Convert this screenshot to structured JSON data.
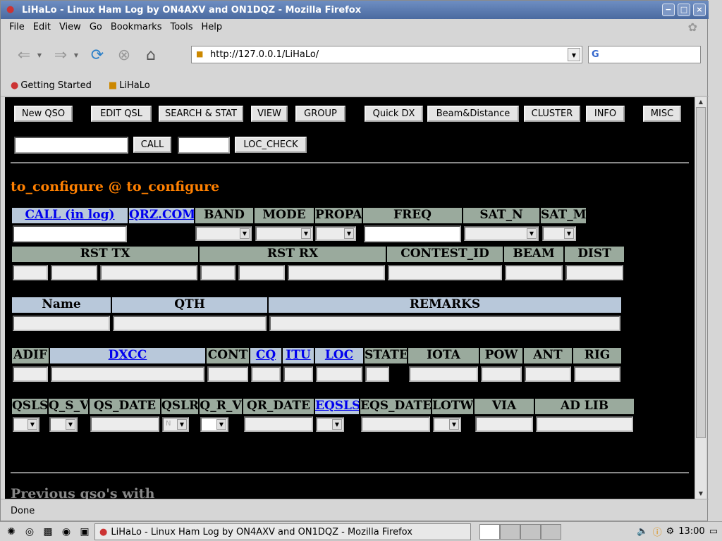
{
  "window": {
    "title": "LiHaLo - Linux Ham Log by ON4AXV and ON1DQZ - Mozilla Firefox",
    "controls": [
      "−",
      "□",
      "×"
    ]
  },
  "menu": [
    "File",
    "Edit",
    "View",
    "Go",
    "Bookmarks",
    "Tools",
    "Help"
  ],
  "nav": {
    "url": "http://127.0.0.1/LiHaLo/",
    "search_placeholder": ""
  },
  "bookmarks": [
    "Getting Started",
    "LiHaLo"
  ],
  "toolbar_buttons": [
    "New QSO",
    "EDIT QSL",
    "SEARCH & STAT",
    "VIEW",
    "GROUP",
    "Quick DX",
    "Beam&Distance",
    "CLUSTER",
    "INFO",
    "MISC"
  ],
  "call_form": {
    "call_button": "CALL",
    "loc_button": "LOC_CHECK"
  },
  "station": "to_configure @ to_configure",
  "row1_headers": [
    {
      "label": "CALL (in log)",
      "link": true
    },
    {
      "label": "QRZ.COM",
      "link": true
    },
    {
      "label": "BAND",
      "link": false
    },
    {
      "label": "MODE",
      "link": false
    },
    {
      "label": "PROPA",
      "link": false
    },
    {
      "label": "FREQ",
      "link": false
    },
    {
      "label": "SAT_N",
      "link": false
    },
    {
      "label": "SAT_M",
      "link": false
    }
  ],
  "row2_headers": [
    "RST TX",
    "RST RX",
    "CONTEST_ID",
    "BEAM",
    "DIST"
  ],
  "row3_headers": [
    "Name",
    "QTH",
    "REMARKS"
  ],
  "row4_headers": [
    {
      "label": "ADIF",
      "link": false
    },
    {
      "label": "DXCC",
      "link": true
    },
    {
      "label": "CONT",
      "link": false
    },
    {
      "label": "CQ",
      "link": true
    },
    {
      "label": "ITU",
      "link": true
    },
    {
      "label": "LOC",
      "link": true
    },
    {
      "label": "STATE",
      "link": false
    },
    {
      "label": "IOTA",
      "link": false
    },
    {
      "label": "POW",
      "link": false
    },
    {
      "label": "ANT",
      "link": false
    },
    {
      "label": "RIG",
      "link": false
    }
  ],
  "row5_headers": [
    {
      "label": "QSLS",
      "link": false
    },
    {
      "label": "Q_S_V",
      "link": false
    },
    {
      "label": "QS_DATE",
      "link": false
    },
    {
      "label": "QSLR",
      "link": false
    },
    {
      "label": "Q_R_V",
      "link": false
    },
    {
      "label": "QR_DATE",
      "link": false
    },
    {
      "label": "EQSLS",
      "link": true
    },
    {
      "label": "EQS_DATE",
      "link": false
    },
    {
      "label": "LOTW",
      "link": false
    },
    {
      "label": "VIA",
      "link": false
    },
    {
      "label": "AD LIB",
      "link": false
    }
  ],
  "qslr_value": "N",
  "previous": "Previous qso's with",
  "status": "Done",
  "taskbar": {
    "task_title": "LiHaLo - Linux Ham Log by ON4AXV and ON1DQZ - Mozilla Firefox",
    "clock": "13:00"
  }
}
